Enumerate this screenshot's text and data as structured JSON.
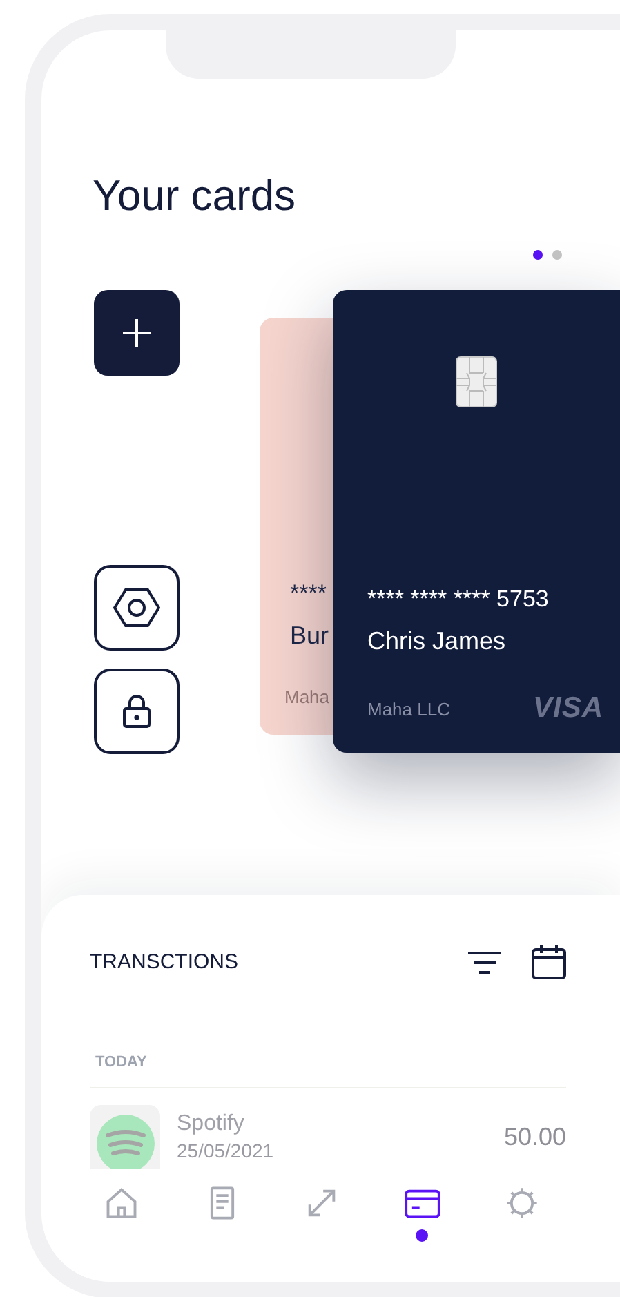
{
  "title": "Your cards",
  "pager": [
    {
      "selected": true
    },
    {
      "selected": false
    }
  ],
  "cards": [
    {
      "kind": "light",
      "number": "****",
      "holder": "Bur",
      "company": "Maha"
    },
    {
      "kind": "dark",
      "number": "**** **** **** 5753",
      "holder": "Chris James",
      "company": "Maha LLC",
      "brand": "VISA"
    }
  ],
  "transactions": {
    "title": "TRANSCTIONS",
    "groups": [
      {
        "label": "TODAY",
        "items": [
          {
            "name": "Spotify",
            "date": "25/05/2021",
            "amount": "50.00"
          }
        ]
      }
    ]
  },
  "nav": [
    {
      "selected": false
    },
    {
      "selected": false
    },
    {
      "selected": false
    },
    {
      "selected": true
    },
    {
      "selected": false
    }
  ]
}
